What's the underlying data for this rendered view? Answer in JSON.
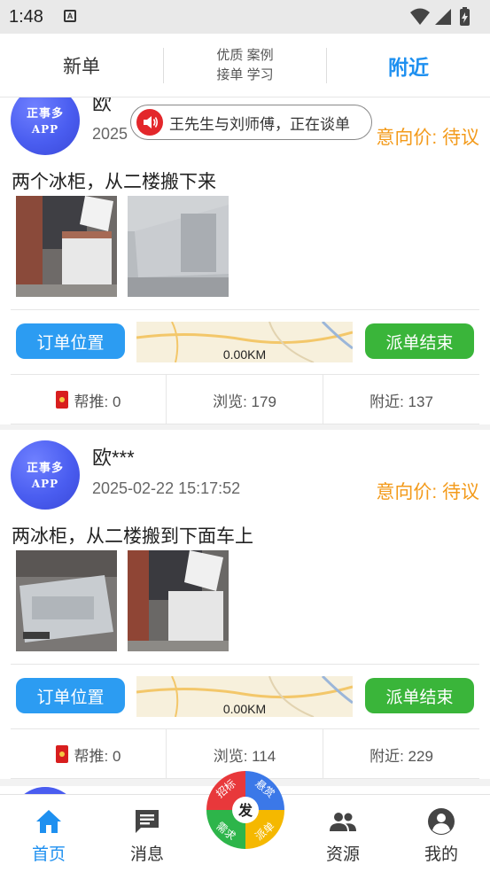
{
  "status_bar": {
    "time": "1:48",
    "notification_letter": "A"
  },
  "top_tabs": [
    {
      "label": "新单"
    },
    {
      "line1": "优质 案例",
      "line2": "接单 学习"
    },
    {
      "label": "附近"
    }
  ],
  "notice": {
    "text": "王先生与刘师傅，正在谈单"
  },
  "avatar_text": {
    "line1": "正事多",
    "line2": "APP"
  },
  "cards": [
    {
      "name": "欧",
      "date": "2025",
      "price": "意向价: 待议",
      "description": "两个冰柜，从二楼搬下来",
      "location_button": "订单位置",
      "map_distance": "0.00KM",
      "finish_button": "派单结束",
      "help_push": "帮推: 0",
      "views": "浏览: 179",
      "nearby": "附近: 137"
    },
    {
      "name": "欧***",
      "date": "2025-02-22 15:17:52",
      "price": "意向价: 待议",
      "description": "两冰柜，从二楼搬到下面车上",
      "location_button": "订单位置",
      "map_distance": "0.00KM",
      "finish_button": "派单结束",
      "help_push": "帮推: 0",
      "views": "浏览: 114",
      "nearby": "附近: 229"
    }
  ],
  "bottom_nav": [
    {
      "label": "首页",
      "icon": "home-icon",
      "active": true
    },
    {
      "label": "消息",
      "icon": "message-icon",
      "active": false
    },
    {
      "label": "资源",
      "icon": "people-icon",
      "active": false
    },
    {
      "label": "我的",
      "icon": "profile-icon",
      "active": false
    }
  ],
  "fab": {
    "center": "发",
    "segments": [
      "招标",
      "悬赏",
      "派单",
      "需求"
    ]
  },
  "colors": {
    "accent_blue": "#1e90f0",
    "price_orange": "#f39a1a",
    "finish_green": "#3ab53a",
    "location_blue": "#2c9cf2"
  }
}
